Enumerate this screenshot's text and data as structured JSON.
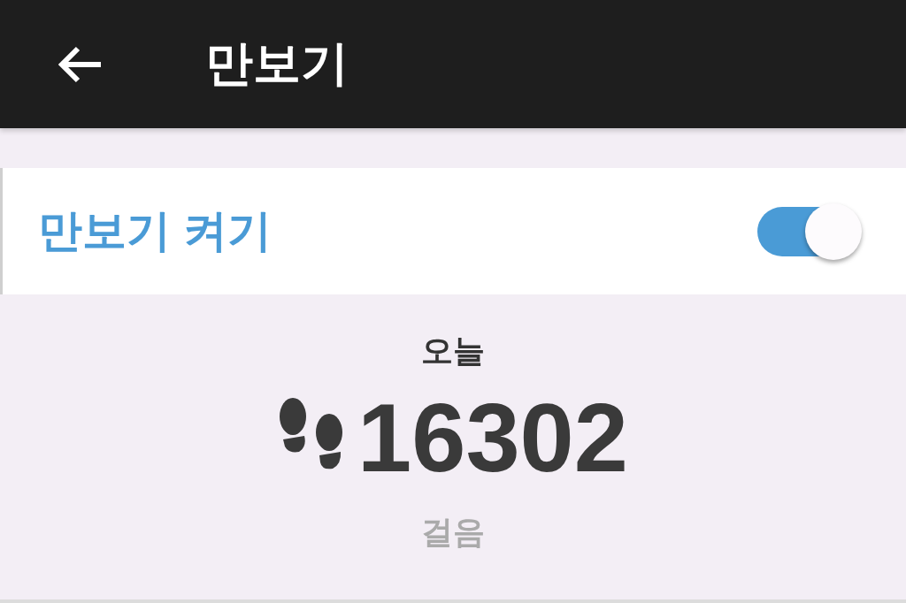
{
  "app_bar": {
    "title": "만보기"
  },
  "setting": {
    "label": "만보기 켜기",
    "on": true
  },
  "today": {
    "label": "오늘",
    "steps": "16302",
    "unit": "걸음"
  }
}
